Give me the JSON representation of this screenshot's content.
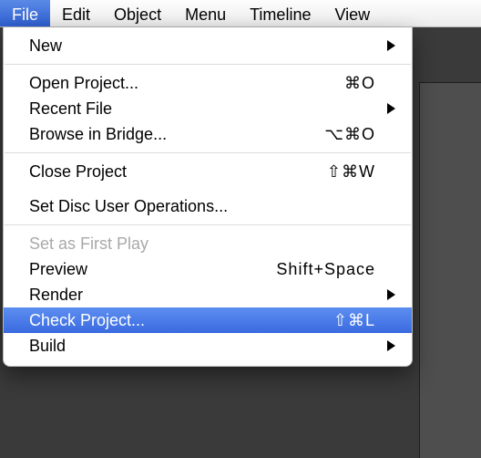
{
  "menubar": {
    "items": [
      {
        "label": "File",
        "active": true
      },
      {
        "label": "Edit",
        "active": false
      },
      {
        "label": "Object",
        "active": false
      },
      {
        "label": "Menu",
        "active": false
      },
      {
        "label": "Timeline",
        "active": false
      },
      {
        "label": "View",
        "active": false
      }
    ]
  },
  "file_menu": {
    "items": [
      {
        "label": "New",
        "submenu": true
      },
      {
        "separator": true
      },
      {
        "label": "Open Project...",
        "shortcut": "⌘O"
      },
      {
        "label": "Recent File",
        "submenu": true
      },
      {
        "label": "Browse in Bridge...",
        "shortcut": "⌥⌘O"
      },
      {
        "separator": true
      },
      {
        "label": "Close Project",
        "shortcut": "⇧⌘W"
      },
      {
        "clipped": true
      },
      {
        "label": "Set Disc User Operations..."
      },
      {
        "separator": true
      },
      {
        "label": "Set as First Play",
        "disabled": true
      },
      {
        "label": "Preview",
        "shortcut": "Shift+Space"
      },
      {
        "label": "Render",
        "submenu": true
      },
      {
        "label": "Check Project...",
        "shortcut": "⇧⌘L",
        "highlight": true
      },
      {
        "label": "Build",
        "submenu": true
      }
    ]
  }
}
